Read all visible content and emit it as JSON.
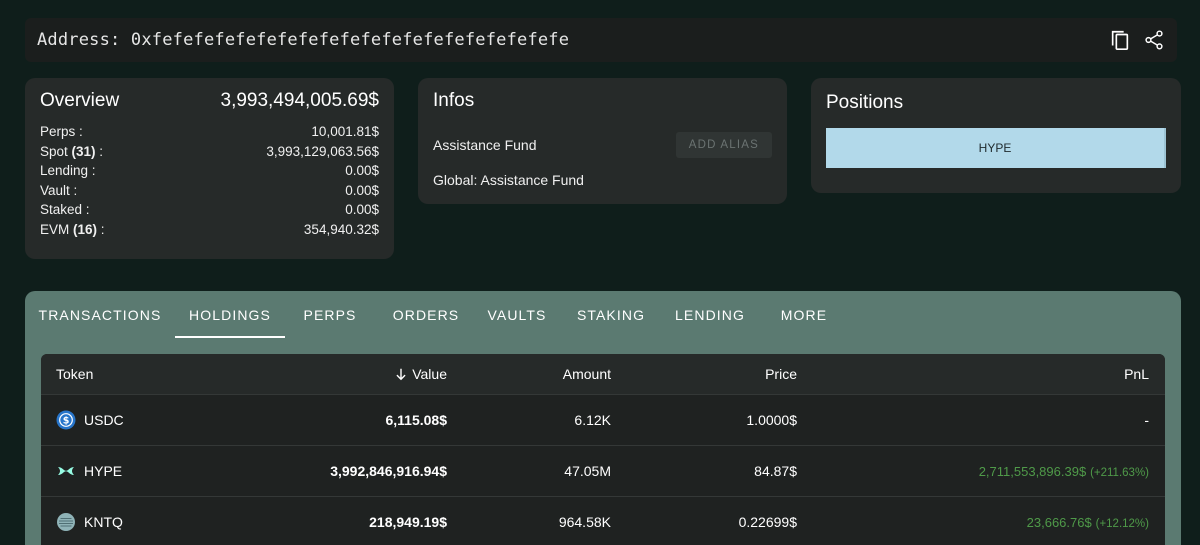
{
  "address": {
    "label": "Address: 0xfefefefefefefefefefefefefefefefefefefefe"
  },
  "overview": {
    "title": "Overview",
    "total": "3,993,494,005.69$",
    "rows": [
      {
        "label": "Perps :",
        "count": "",
        "value": "10,001.81$"
      },
      {
        "label": "Spot ",
        "count": "(31)",
        "suffix": " :",
        "value": "3,993,129,063.56$"
      },
      {
        "label": "Lending :",
        "count": "",
        "value": "0.00$"
      },
      {
        "label": "Vault :",
        "count": "",
        "value": "0.00$"
      },
      {
        "label": "Staked :",
        "count": "",
        "value": "0.00$"
      },
      {
        "label": "EVM ",
        "count": "(16)",
        "suffix": " :",
        "value": "354,940.32$"
      }
    ]
  },
  "infos": {
    "title": "Infos",
    "name": "Assistance Fund",
    "alias_button": "ADD ALIAS",
    "global": "Global: Assistance Fund"
  },
  "positions": {
    "title": "Positions",
    "items": [
      "HYPE"
    ],
    "colors": {
      "chip": "#b2d9ea"
    }
  },
  "tabs": [
    "TRANSACTIONS",
    "HOLDINGS",
    "PERPS",
    "ORDERS",
    "VAULTS",
    "STAKING",
    "LENDING",
    "MORE"
  ],
  "active_tab": "HOLDINGS",
  "table": {
    "headers": {
      "token": "Token",
      "value": "Value",
      "amount": "Amount",
      "price": "Price",
      "pnl": "PnL"
    },
    "sort_icon": "arrow-down-icon",
    "rows": [
      {
        "token": "USDC",
        "icon": "usdc-icon",
        "value": "6,115.08$",
        "amount": "6.12K",
        "price": "1.0000$",
        "pnl": "-",
        "pnl_pct": ""
      },
      {
        "token": "HYPE",
        "icon": "hype-icon",
        "value": "3,992,846,916.94$",
        "amount": "47.05M",
        "price": "84.87$",
        "pnl": "2,711,553,896.39$",
        "pnl_pct": "(+211.63%)"
      },
      {
        "token": "KNTQ",
        "icon": "kntq-icon",
        "value": "218,949.19$",
        "amount": "964.58K",
        "price": "0.22699$",
        "pnl": "23,666.76$",
        "pnl_pct": "(+12.12%)"
      }
    ]
  },
  "colors": {
    "background": "#0f1e1b",
    "card": "#262a29",
    "tab_bar": "#5b7a71",
    "pnl_positive": "#4f9a49"
  }
}
